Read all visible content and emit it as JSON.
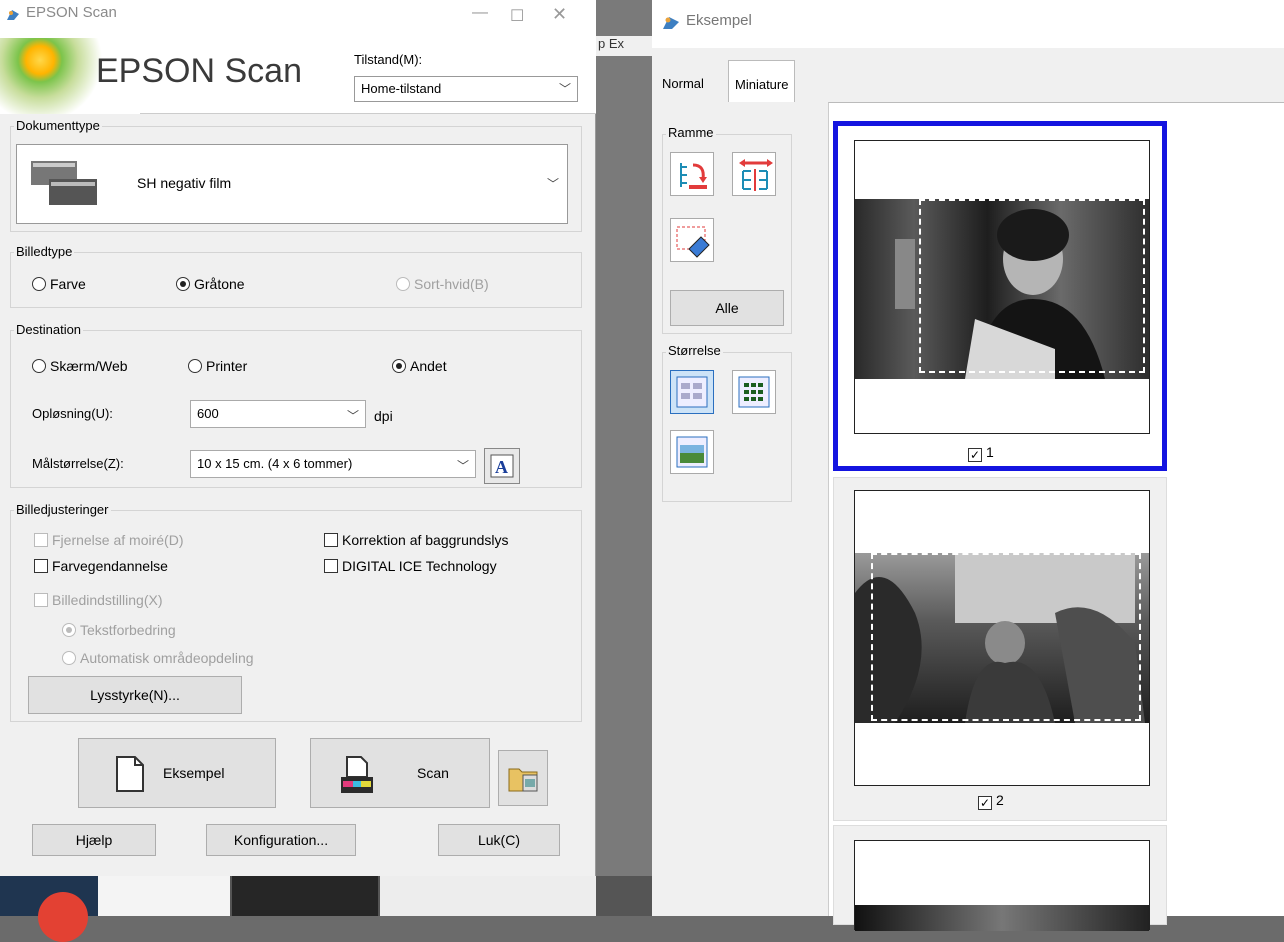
{
  "epson": {
    "window_title": "EPSON Scan",
    "brand": "EPSON Scan",
    "mode_label": "Tilstand(M):",
    "mode_value": "Home-tilstand",
    "doc_type": {
      "legend": "Dokumenttype",
      "value": "SH negativ film"
    },
    "image_type": {
      "legend": "Billedtype",
      "options": [
        "Farve",
        "Gråtone",
        "Sort-hvid(B)"
      ],
      "selected": "Gråtone"
    },
    "destination": {
      "legend": "Destination",
      "options": [
        "Skærm/Web",
        "Printer",
        "Andet"
      ],
      "selected": "Andet",
      "resolution_label": "Opløsning(U):",
      "resolution_value": "600",
      "resolution_unit": "dpi",
      "target_size_label": "Målstørrelse(Z):",
      "target_size_value": "10 x 15 cm. (4 x 6 tommer)"
    },
    "adjustments": {
      "legend": "Billedjusteringer",
      "moire": "Fjernelse af moiré(D)",
      "backlight": "Korrektion af baggrundslys",
      "color_restore": "Farvegendannelse",
      "digital_ice": "DIGITAL ICE Technology",
      "image_setting": "Billedindstilling(X)",
      "text_enhance": "Tekstforbedring",
      "auto_area": "Automatisk områdeopdeling",
      "brightness_button": "Lysstyrke(N)..."
    },
    "buttons": {
      "preview": "Eksempel",
      "scan": "Scan",
      "help": "Hjælp",
      "config": "Konfiguration...",
      "close": "Luk(C)"
    }
  },
  "background_fragment": "p  Ex",
  "preview": {
    "window_title": "Eksempel",
    "tabs": [
      "Normal",
      "Miniature"
    ],
    "active_tab": "Miniature",
    "frame_group": "Ramme",
    "all_button": "Alle",
    "size_group": "Størrelse",
    "thumbnails": [
      {
        "label": "1",
        "checked": true,
        "selected": true
      },
      {
        "label": "2",
        "checked": true,
        "selected": false
      }
    ]
  }
}
